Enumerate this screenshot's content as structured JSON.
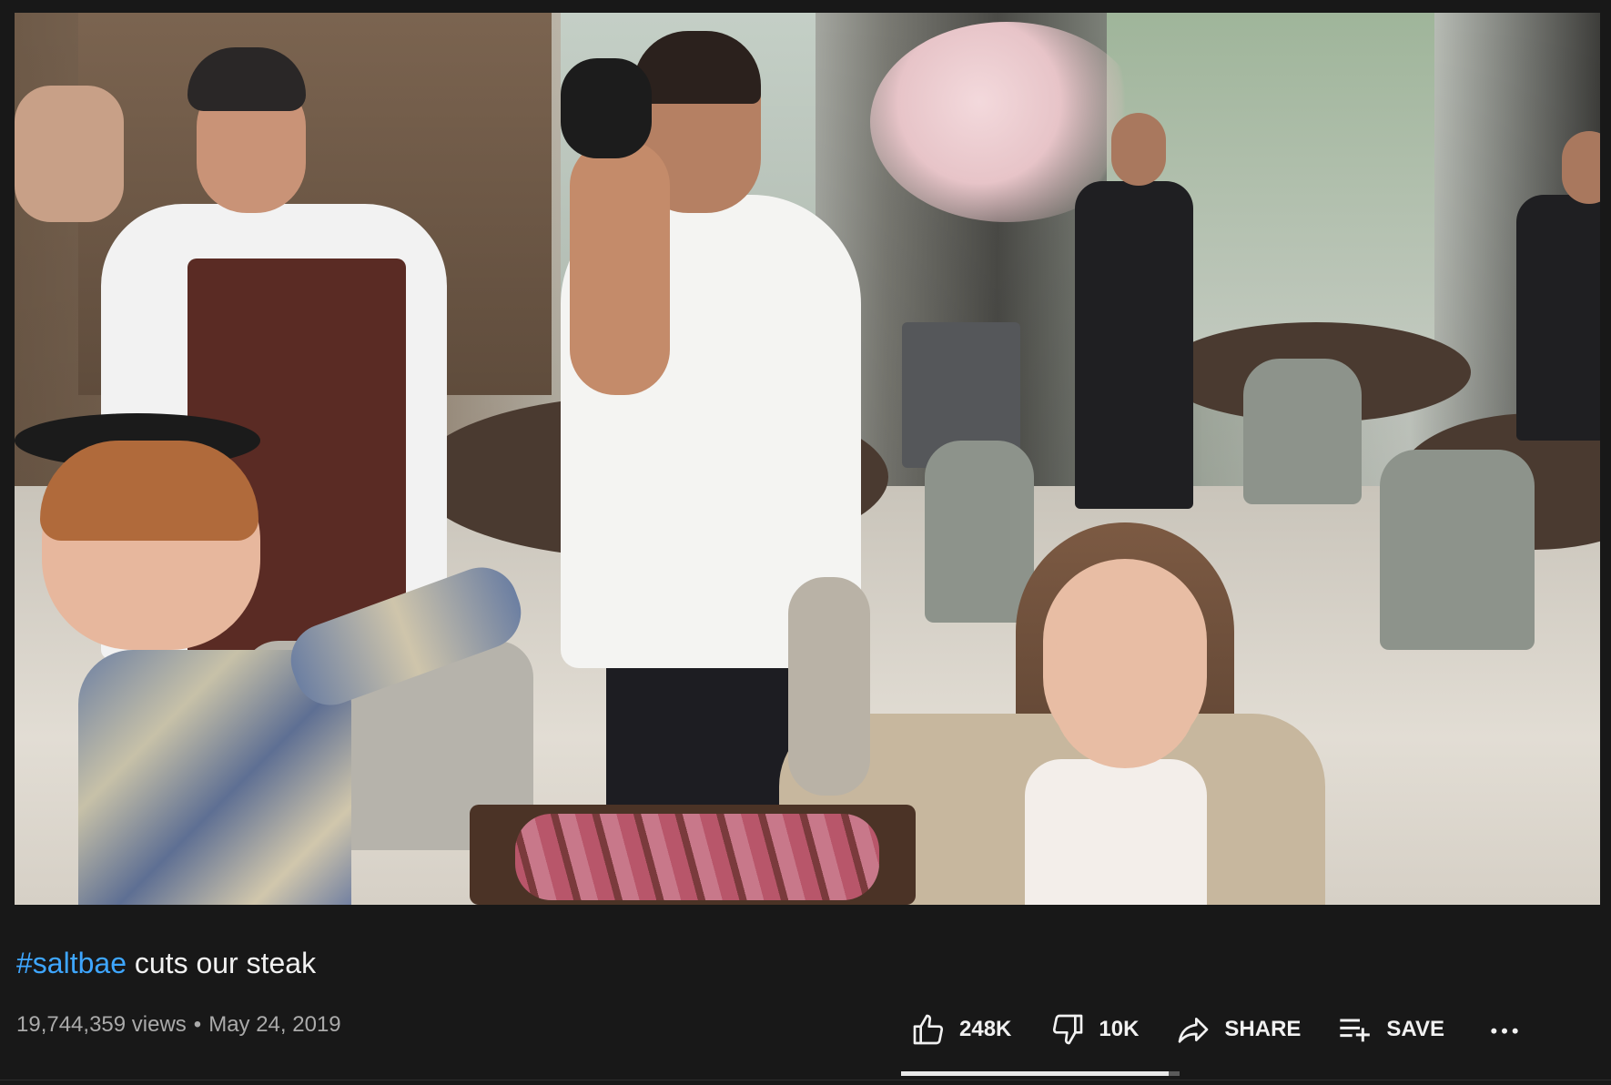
{
  "video": {
    "title_hashtag": "#saltbae",
    "title_rest": " cuts our steak",
    "views": "19,744,359 views",
    "separator": "•",
    "date": "May 24, 2019"
  },
  "actions": {
    "like_count": "248K",
    "dislike_count": "10K",
    "share_label": "SHARE",
    "save_label": "SAVE",
    "more_label": "..."
  },
  "sentiment": {
    "like_ratio": 0.961
  },
  "icons": {
    "like": "thumbs-up-icon",
    "dislike": "thumbs-down-icon",
    "share": "share-arrow-icon",
    "save": "playlist-add-icon",
    "more": "more-horizontal-icon"
  },
  "colors": {
    "background": "#181818",
    "text": "#f1f1f1",
    "secondary_text": "#aaaaaa",
    "hashtag_link": "#3ea6ff"
  }
}
